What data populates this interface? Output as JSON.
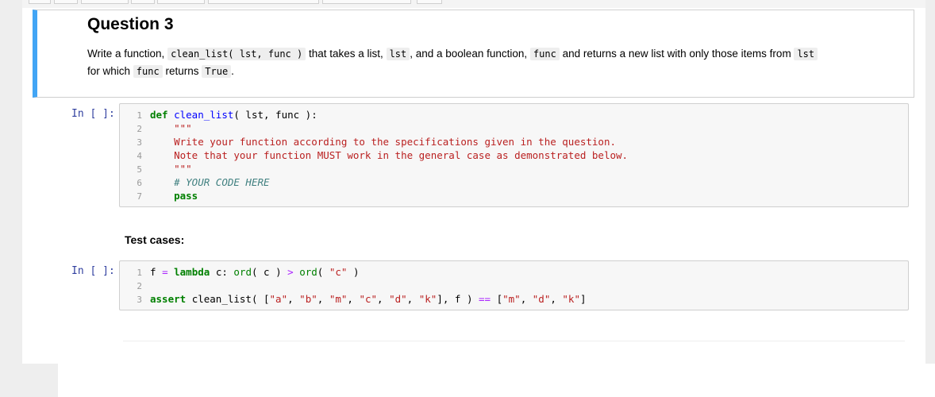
{
  "markdown": {
    "title": "Question 3",
    "line1_prefix": "Write a function,",
    "code_signature": "clean_list( lst, func )",
    "line1_mid1": "that takes a list,",
    "code_lst": "lst",
    "line1_mid2": ", and a boolean function,",
    "code_func": "func",
    "line1_mid3": "and returns a new list with only those items from",
    "code_lst2": "lst",
    "line2_prefix": "for which",
    "code_func2": "func",
    "line2_mid": "returns",
    "code_true": "True",
    "line2_end": "."
  },
  "cell1": {
    "prompt": "In [ ]:",
    "line_numbers": [
      "1",
      "2",
      "3",
      "4",
      "5",
      "6",
      "7"
    ],
    "def_kw": "def",
    "fn_name": "clean_list",
    "def_rest": "( lst, func ):",
    "docstring_open": "\"\"\"",
    "doc_line1": "Write your function according to the specifications given in the question.",
    "doc_line2": "Note that your function MUST work in the general case as demonstrated below.",
    "docstring_close": "\"\"\"",
    "comment": "# YOUR CODE HERE",
    "pass_kw": "pass"
  },
  "test_label": "Test cases:",
  "cell2": {
    "prompt": "In [ ]:",
    "line_numbers": [
      "1",
      "2",
      "3"
    ],
    "l1_var": "f",
    "l1_eq": "=",
    "l1_lambda": "lambda",
    "l1_param": "c:",
    "l1_ord1": "ord",
    "l1_arg1": "( c )",
    "l1_gt": ">",
    "l1_ord2": "ord",
    "l1_open": "(",
    "l1_str": "\"c\"",
    "l1_close": ")",
    "l3_assert": "assert",
    "l3_call": "clean_list( [",
    "l3_items": [
      "\"a\"",
      "\"b\"",
      "\"m\"",
      "\"c\"",
      "\"d\"",
      "\"k\""
    ],
    "l3_mid": "], f )",
    "l3_eqeq": "==",
    "l3_open": "[",
    "l3_result": [
      "\"m\"",
      "\"d\"",
      "\"k\""
    ],
    "l3_close": "]"
  }
}
